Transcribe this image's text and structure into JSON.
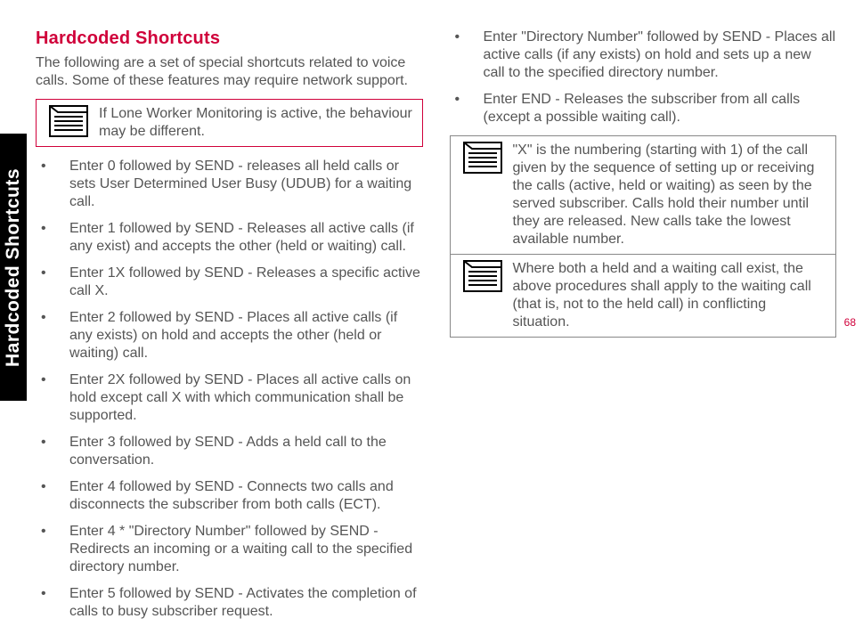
{
  "sideTab": "Hardcoded Shortcuts",
  "title": "Hardcoded Shortcuts",
  "intro": "The following are a set of special shortcuts related to voice calls. Some of these features may require network support.",
  "note1": "If Lone Worker Monitoring is active, the behaviour may be different.",
  "leftItems": [
    "Enter 0 followed by SEND - releases all held calls or sets User Determined User Busy (UDUB) for a waiting call.",
    "Enter 1 followed by SEND - Releases all active calls (if any exist) and accepts the other (held or waiting) call.",
    "Enter 1X followed by SEND - Releases a specific active call X.",
    "Enter 2 followed by SEND - Places all active calls (if any exists) on hold and accepts the other (held or waiting) call.",
    "Enter 2X followed by SEND - Places all active calls on hold except call X with which communication shall be   supported.",
    "Enter 3 followed by SEND - Adds a held call to the conversation.",
    "Enter 4 followed by SEND - Connects two calls and disconnects the subscriber from both calls (ECT).",
    "Enter 4 * \"Directory Number\" followed by SEND - Redirects an incoming or a waiting call to the specified directory number.",
    "Enter 5 followed by SEND - Activates the completion of calls to busy subscriber request."
  ],
  "rightItems": [
    "Enter \"Directory Number\" followed by SEND - Places all active calls (if any exists) on hold and sets up a new call to the specified directory number.",
    "Enter END - Releases the subscriber from all calls (except a possible waiting call)."
  ],
  "note2": "\"X\" is the numbering (starting with 1) of the call given by the sequence of setting up or receiving the calls (active, held or waiting) as seen by the served subscriber. Calls hold their number until they are  released. New calls take the lowest available number.",
  "note3": "Where both a held and a waiting call exist, the above procedures shall apply to the waiting call (that is, not to the held call) in conflicting situation.",
  "pageNumber": "68"
}
